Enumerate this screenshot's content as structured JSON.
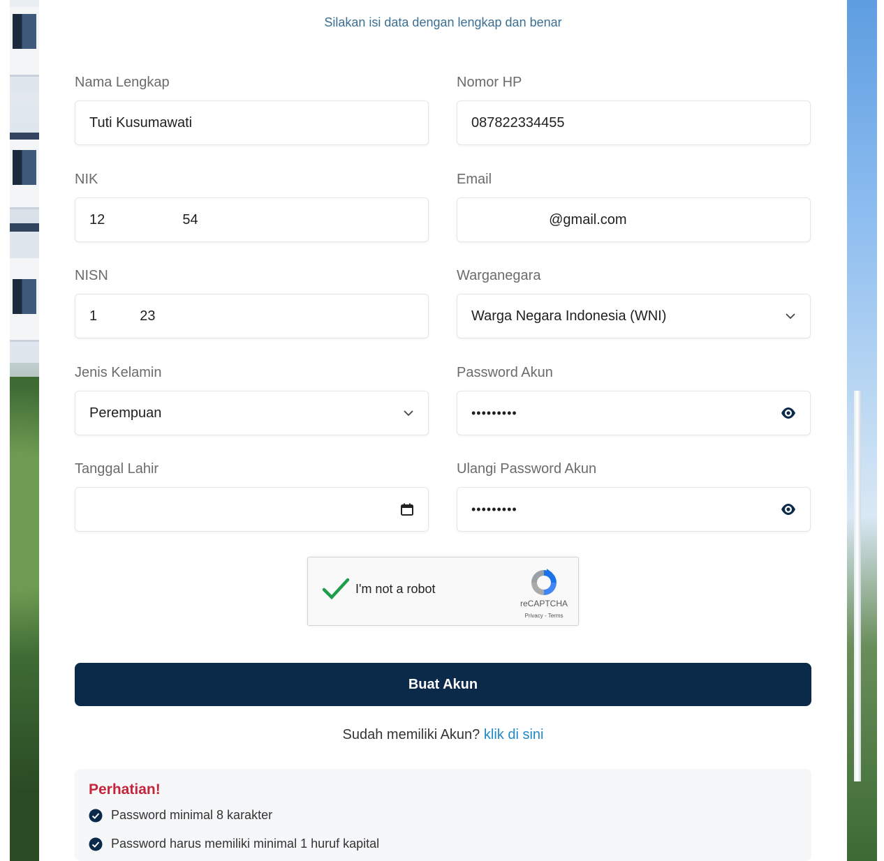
{
  "header": {
    "subtitle": "Silakan isi data dengan lengkap dan benar"
  },
  "form": {
    "nama": {
      "label": "Nama Lengkap",
      "value": "Tuti Kusumawati"
    },
    "hp": {
      "label": "Nomor HP",
      "value": "087822334455"
    },
    "nik": {
      "label": "NIK",
      "value": "12                    54"
    },
    "email": {
      "label": "Email",
      "value": "                    @gmail.com"
    },
    "nisn": {
      "label": "NISN",
      "value": "1           23"
    },
    "warganegara": {
      "label": "Warganegara",
      "value": "Warga Negara Indonesia (WNI)"
    },
    "gender": {
      "label": "Jenis Kelamin",
      "value": "Perempuan"
    },
    "password": {
      "label": "Password Akun",
      "value": "•••••••••"
    },
    "birthdate": {
      "label": "Tanggal Lahir",
      "value": ""
    },
    "password_confirm": {
      "label": "Ulangi Password Akun",
      "value": "•••••••••"
    }
  },
  "captcha": {
    "text": "I'm not a robot",
    "brand": "reCAPTCHA",
    "links": "Privacy - Terms"
  },
  "submit": {
    "label": "Buat Akun"
  },
  "login": {
    "prompt": "Sudah memiliki Akun?",
    "link": "klik di sini"
  },
  "notice": {
    "title": "Perhatian!",
    "items": [
      "Password minimal 8 karakter",
      "Password harus memiliki minimal 1 huruf kapital"
    ]
  },
  "colors": {
    "primary": "#0b2a4a",
    "link": "#1e88c9",
    "alert": "#c4253b",
    "check": "#0b2a4a"
  }
}
